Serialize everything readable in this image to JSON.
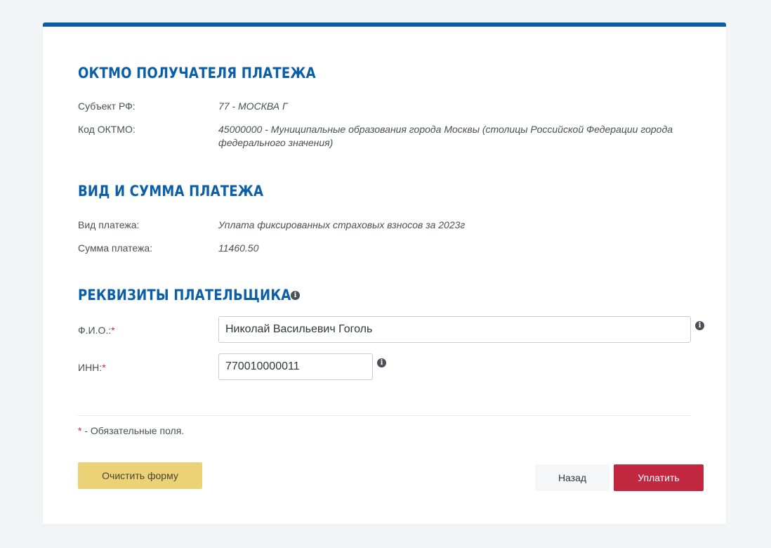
{
  "oktmo_section": {
    "title": "ОКТМО ПОЛУЧАТЕЛЯ ПЛАТЕЖА",
    "subject_label": "Субъект РФ:",
    "subject_value": "77 - МОСКВА Г",
    "code_label": "Код ОКТМО:",
    "code_value": "45000000 - Муниципальные образования города Москвы (столицы Российской Федерации города федерального значения)"
  },
  "payment_section": {
    "title": "ВИД И СУММА ПЛАТЕЖА",
    "type_label": "Вид платежа:",
    "type_value": "Уплата фиксированных страховых взносов за 2023г",
    "amount_label": "Сумма платежа:",
    "amount_value": "11460.50"
  },
  "payer_section": {
    "title": "РЕКВИЗИТЫ ПЛАТЕЛЬЩИКА",
    "name_label": "Ф.И.О.:",
    "name_value": "Николай Васильевич Гоголь",
    "inn_label": "ИНН:",
    "inn_value": "770010000011",
    "required_mark": "*"
  },
  "footer": {
    "required_mark": "*",
    "required_note": " - Обязательные поля."
  },
  "buttons": {
    "clear_label": "Очистить форму",
    "back_label": "Назад",
    "pay_label": "Уплатить"
  },
  "icons": {
    "info": "info-icon"
  },
  "colors": {
    "accent_blue": "#0b5ea8",
    "pay_red": "#c1283f",
    "clear_yellow": "#ecd277",
    "required_red": "#c8283d"
  }
}
